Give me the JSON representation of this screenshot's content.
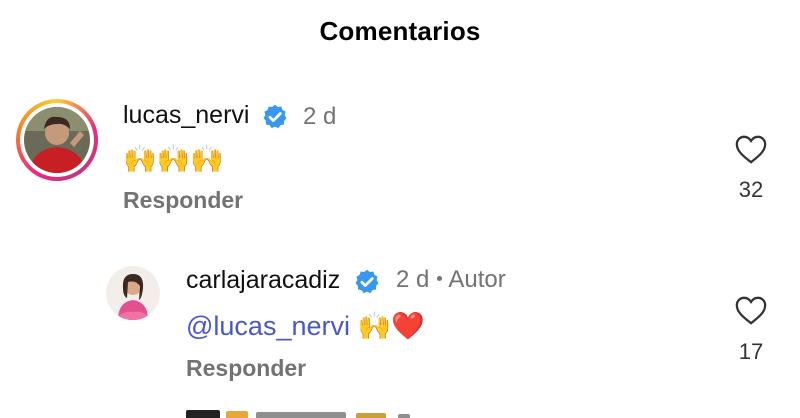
{
  "header": {
    "title": "Comentarios"
  },
  "comments": [
    {
      "username": "lucas_nervi",
      "verified": true,
      "time": "2 d",
      "text": "🙌🙌🙌",
      "reply_label": "Responder",
      "likes": "32"
    },
    {
      "username": "carlajaracadiz",
      "verified": true,
      "time": "2 d",
      "author_badge": "Autor",
      "mention": "@lucas_nervi",
      "text": "🙌❤️",
      "reply_label": "Responder",
      "likes": "17"
    }
  ],
  "colors": {
    "verified_blue": "#3897f0",
    "mention": "#4a57c7",
    "muted": "#737373"
  },
  "icons": [
    "verified-badge-icon",
    "heart-outline-icon",
    "threads-icon"
  ]
}
